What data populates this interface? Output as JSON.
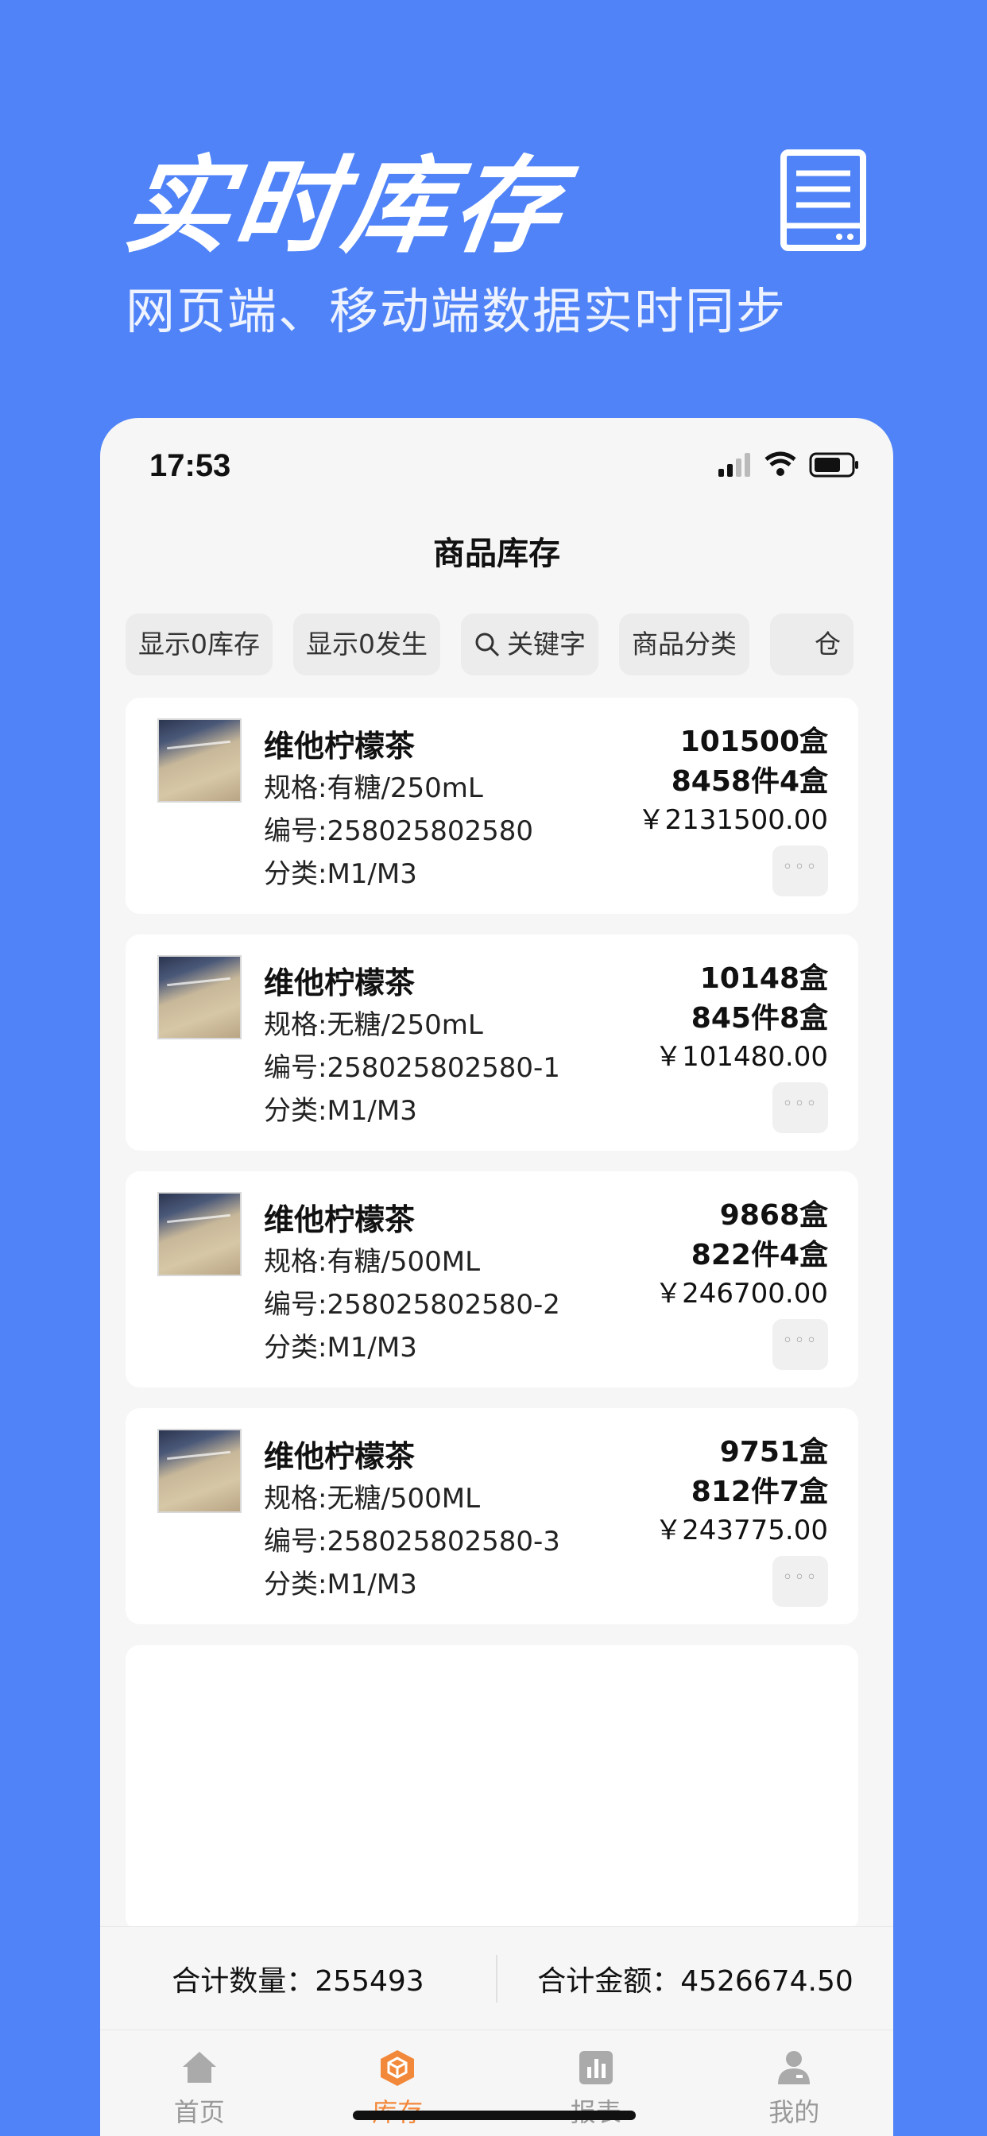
{
  "hero": {
    "title": "实时库存",
    "subtitle": "网页端、移动端数据实时同步"
  },
  "status_bar": {
    "time": "17:53"
  },
  "nav": {
    "title": "商品库存"
  },
  "filters": [
    {
      "label": "显示0库存"
    },
    {
      "label": "显示0发生"
    },
    {
      "label": "关键字",
      "icon": "search-icon"
    },
    {
      "label": "商品分类"
    },
    {
      "label": "仓"
    }
  ],
  "products": [
    {
      "name": "维他柠檬茶",
      "spec": "规格:有糖/250mL",
      "code": "编号:258025802580",
      "category": "分类:M1/M3",
      "qty_box": "101500盒",
      "qty_pack": "8458件4盒",
      "amount": "￥2131500.00"
    },
    {
      "name": "维他柠檬茶",
      "spec": "规格:无糖/250mL",
      "code": "编号:258025802580-1",
      "category": "分类:M1/M3",
      "qty_box": "10148盒",
      "qty_pack": "845件8盒",
      "amount": "￥101480.00"
    },
    {
      "name": "维他柠檬茶",
      "spec": "规格:有糖/500ML",
      "code": "编号:258025802580-2",
      "category": "分类:M1/M3",
      "qty_box": "9868盒",
      "qty_pack": "822件4盒",
      "amount": "￥246700.00"
    },
    {
      "name": "维他柠檬茶",
      "spec": "规格:无糖/500ML",
      "code": "编号:258025802580-3",
      "category": "分类:M1/M3",
      "qty_box": "9751盒",
      "qty_pack": "812件7盒",
      "amount": "￥243775.00"
    }
  ],
  "more_label": "◦◦◦",
  "summary": {
    "total_qty": "合计数量：255493",
    "total_amount": "合计金额：4526674.50"
  },
  "tabs": [
    {
      "label": "首页",
      "icon": "home-icon"
    },
    {
      "label": "库存",
      "icon": "inventory-icon",
      "active": true
    },
    {
      "label": "报表",
      "icon": "report-icon"
    },
    {
      "label": "我的",
      "icon": "profile-icon"
    }
  ],
  "colors": {
    "background": "#4F83F7",
    "active_tab": "#F2883A",
    "inactive_tab": "#999999"
  }
}
